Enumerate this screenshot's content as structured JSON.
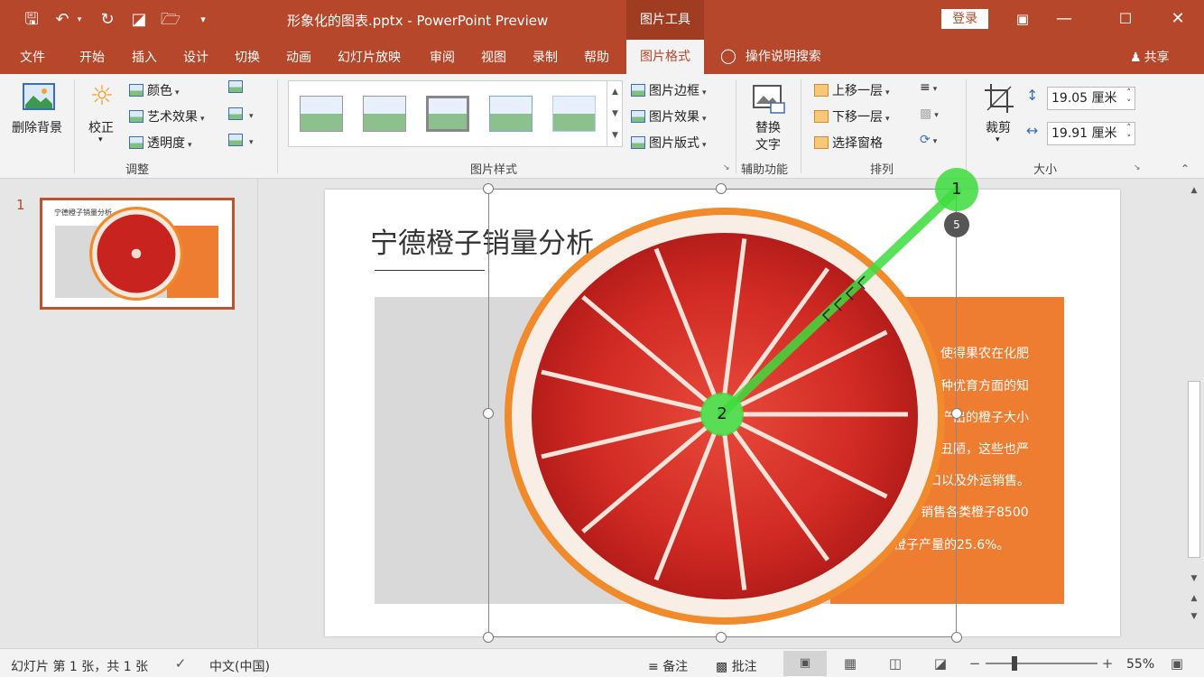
{
  "titlebar": {
    "doc_title": "形象化的图表.pptx  -  PowerPoint Preview",
    "tool_group": "图片工具",
    "login": "登录"
  },
  "tabs": [
    "文件",
    "开始",
    "插入",
    "设计",
    "切换",
    "动画",
    "幻灯片放映",
    "审阅",
    "视图",
    "录制",
    "帮助"
  ],
  "active_tab": "图片格式",
  "tell_me": "操作说明搜索",
  "share": "共享",
  "ribbon": {
    "remove_bg": "删除背景",
    "corrections": "校正",
    "color": "颜色",
    "artistic": "艺术效果",
    "transparency": "透明度",
    "group_adjust": "调整",
    "picture_border": "图片边框",
    "picture_effects": "图片效果",
    "picture_layout": "图片版式",
    "group_styles": "图片样式",
    "alt_text_line1": "替换",
    "alt_text_line2": "文字",
    "group_accessibility": "辅助功能",
    "bring_forward": "上移一层",
    "send_backward": "下移一层",
    "selection_pane": "选择窗格",
    "group_arrange": "排列",
    "crop": "裁剪",
    "height": "19.05 厘米",
    "width": "19.91 厘米",
    "group_size": "大小"
  },
  "slides_pane": {
    "slide_number": "1",
    "thumb_title": "宁德橙子销量分析"
  },
  "slide": {
    "title": "宁德橙子销量分析",
    "body_lines": [
      "使得果农在化肥",
      "种优育方面的知",
      "产出的橙子大小",
      "丑陋，这些也严",
      "口以及外运销售。",
      "计销售各类橙子8500",
      "橙子产量的25.6%。"
    ]
  },
  "annotations": {
    "start_label": "1",
    "end_label": "2",
    "badge_label": "5",
    "marker_color": "#3ddc3d"
  },
  "status": {
    "slide_info": "幻灯片 第 1 张，共 1 张",
    "language": "中文(中国)",
    "notes": "备注",
    "comments": "批注",
    "zoom": "55%"
  },
  "colors": {
    "accent": "#b7472a",
    "orange": "#ee7d31",
    "grey_box": "#d9d9d9"
  }
}
